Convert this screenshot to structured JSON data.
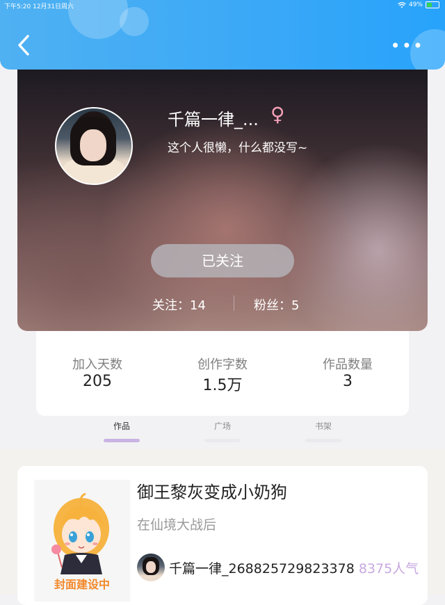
{
  "status_bar": {
    "time": "下午5:20",
    "date": "12月31日周六",
    "battery": "49%"
  },
  "profile": {
    "name": "千篇一律_...",
    "gender_symbol": "♀",
    "signature": "这个人很懒，什么都没写~",
    "follow_button": "已关注",
    "following_label": "关注：14",
    "fans_label": "粉丝：5"
  },
  "stats": [
    {
      "label": "加入天数",
      "value": "205"
    },
    {
      "label": "创作字数",
      "value": "1.5万"
    },
    {
      "label": "作品数量",
      "value": "3"
    }
  ],
  "tabs": [
    {
      "label": "作品",
      "active": true
    },
    {
      "label": "广场",
      "active": false
    },
    {
      "label": "书架",
      "active": false
    }
  ],
  "work": {
    "cover_text": "封面建设中",
    "title": "御王黎灰变成小奶狗",
    "subtitle": "在仙境大战后",
    "author": "千篇一律_268825729823378",
    "popularity": "8375人气"
  },
  "icons": {
    "back": "chevron-left-icon",
    "more": "more-dots-icon",
    "wifi": "wifi-icon",
    "battery": "battery-icon"
  },
  "colors": {
    "header": "#3aa8f7",
    "tab_active_bar": "#c9b4e3",
    "popularity": "#c8a8e0",
    "cover_text": "#f2882a"
  }
}
